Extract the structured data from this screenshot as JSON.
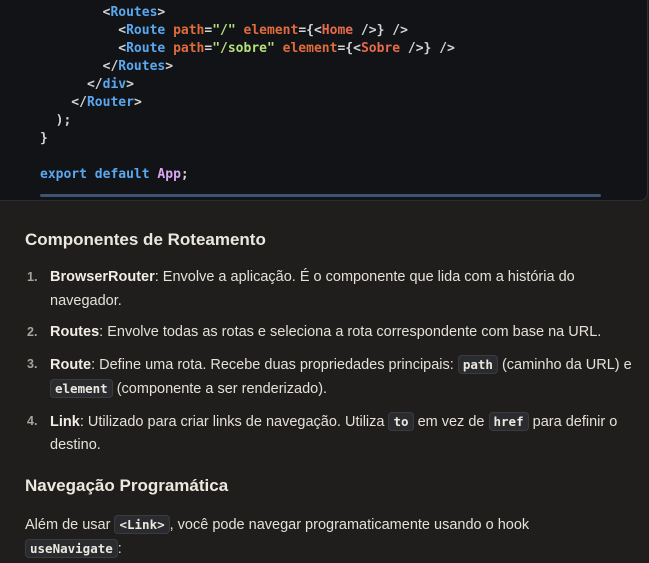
{
  "code": {
    "lines": [
      [
        {
          "t": "punc",
          "v": "        <"
        },
        {
          "t": "tag",
          "v": "Routes"
        },
        {
          "t": "punc",
          "v": ">"
        }
      ],
      [
        {
          "t": "punc",
          "v": "          <"
        },
        {
          "t": "tag",
          "v": "Route"
        },
        {
          "t": "punc",
          "v": " "
        },
        {
          "t": "attr",
          "v": "path"
        },
        {
          "t": "punc",
          "v": "="
        },
        {
          "t": "str",
          "v": "\"/\""
        },
        {
          "t": "punc",
          "v": " "
        },
        {
          "t": "attr",
          "v": "element"
        },
        {
          "t": "punc",
          "v": "={<"
        },
        {
          "t": "comp",
          "v": "Home"
        },
        {
          "t": "punc",
          "v": " />} />"
        }
      ],
      [
        {
          "t": "punc",
          "v": "          <"
        },
        {
          "t": "tag",
          "v": "Route"
        },
        {
          "t": "punc",
          "v": " "
        },
        {
          "t": "attr",
          "v": "path"
        },
        {
          "t": "punc",
          "v": "="
        },
        {
          "t": "str",
          "v": "\"/sobre\""
        },
        {
          "t": "punc",
          "v": " "
        },
        {
          "t": "attr",
          "v": "element"
        },
        {
          "t": "punc",
          "v": "={<"
        },
        {
          "t": "comp",
          "v": "Sobre"
        },
        {
          "t": "punc",
          "v": " />} />"
        }
      ],
      [
        {
          "t": "punc",
          "v": "        </"
        },
        {
          "t": "tag",
          "v": "Routes"
        },
        {
          "t": "punc",
          "v": ">"
        }
      ],
      [
        {
          "t": "punc",
          "v": "      </"
        },
        {
          "t": "tag",
          "v": "div"
        },
        {
          "t": "punc",
          "v": ">"
        }
      ],
      [
        {
          "t": "punc",
          "v": "    </"
        },
        {
          "t": "tag",
          "v": "Router"
        },
        {
          "t": "punc",
          "v": ">"
        }
      ],
      [
        {
          "t": "punc",
          "v": "  );"
        }
      ],
      [
        {
          "t": "punc",
          "v": "}"
        }
      ],
      [],
      [
        {
          "t": "kw",
          "v": "export"
        },
        {
          "t": "punc",
          "v": " "
        },
        {
          "t": "kw",
          "v": "default"
        },
        {
          "t": "punc",
          "v": " "
        },
        {
          "t": "name",
          "v": "App"
        },
        {
          "t": "punc",
          "v": ";"
        }
      ]
    ]
  },
  "section1": {
    "title": "Componentes de Roteamento",
    "items": [
      {
        "num": "1.",
        "parts": [
          {
            "k": "b",
            "v": "BrowserRouter"
          },
          {
            "k": "t",
            "v": ": Envolve a aplicação. É o componente que lida com a história do navegador."
          }
        ]
      },
      {
        "num": "2.",
        "parts": [
          {
            "k": "b",
            "v": "Routes"
          },
          {
            "k": "t",
            "v": ": Envolve todas as rotas e seleciona a rota correspondente com base na URL."
          }
        ]
      },
      {
        "num": "3.",
        "parts": [
          {
            "k": "b",
            "v": "Route"
          },
          {
            "k": "t",
            "v": ": Define uma rota. Recebe duas propriedades principais: "
          },
          {
            "k": "c",
            "v": "path"
          },
          {
            "k": "t",
            "v": " (caminho da URL) e "
          },
          {
            "k": "c",
            "v": "element"
          },
          {
            "k": "t",
            "v": " (componente a ser renderizado)."
          }
        ]
      },
      {
        "num": "4.",
        "parts": [
          {
            "k": "b",
            "v": "Link"
          },
          {
            "k": "t",
            "v": ": Utilizado para criar links de navegação. Utiliza "
          },
          {
            "k": "c",
            "v": "to"
          },
          {
            "k": "t",
            "v": " em vez de "
          },
          {
            "k": "c",
            "v": "href"
          },
          {
            "k": "t",
            "v": " para definir o destino."
          }
        ]
      }
    ]
  },
  "section2": {
    "title": "Navegação Programática",
    "paragraph": [
      {
        "k": "t",
        "v": "Além de usar "
      },
      {
        "k": "c",
        "v": "<Link>"
      },
      {
        "k": "t",
        "v": ", você pode navegar programaticamente usando o hook "
      },
      {
        "k": "c",
        "v": "useNavigate"
      },
      {
        "k": "t",
        "v": ":"
      }
    ]
  }
}
